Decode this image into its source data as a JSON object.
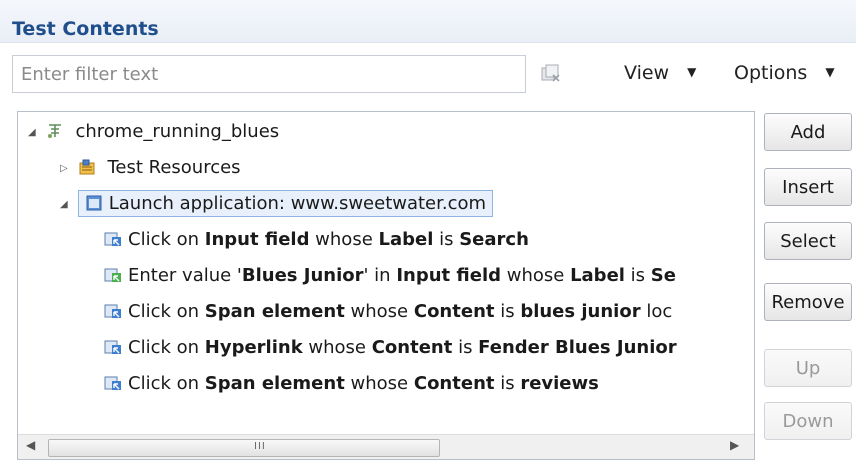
{
  "panel": {
    "title": "Test Contents"
  },
  "filter": {
    "placeholder": "Enter filter text",
    "value": ""
  },
  "menus": {
    "view_label": "View",
    "options_label": "Options"
  },
  "tree": {
    "root": {
      "label": "chrome_running_blues",
      "icon": "test-suite-icon"
    },
    "resources": {
      "label": "Test Resources",
      "icon": "test-resources-icon"
    },
    "launch": {
      "label": "Launch application: www.sweetwater.com",
      "icon": "application-icon"
    },
    "steps": [
      {
        "icon": "click-action-icon",
        "parts": [
          {
            "text": "Click on ",
            "bold": false
          },
          {
            "text": "Input field",
            "bold": true
          },
          {
            "text": " whose ",
            "bold": false
          },
          {
            "text": "Label",
            "bold": true
          },
          {
            "text": " is ",
            "bold": false
          },
          {
            "text": "Search",
            "bold": true
          }
        ]
      },
      {
        "icon": "enter-value-icon",
        "parts": [
          {
            "text": "Enter value '",
            "bold": false
          },
          {
            "text": "Blues Junior",
            "bold": true
          },
          {
            "text": "' in ",
            "bold": false
          },
          {
            "text": "Input field",
            "bold": true
          },
          {
            "text": " whose ",
            "bold": false
          },
          {
            "text": "Label",
            "bold": true
          },
          {
            "text": " is ",
            "bold": false
          },
          {
            "text": "Se",
            "bold": true
          }
        ]
      },
      {
        "icon": "click-action-icon",
        "parts": [
          {
            "text": "Click on ",
            "bold": false
          },
          {
            "text": "Span element",
            "bold": true
          },
          {
            "text": " whose ",
            "bold": false
          },
          {
            "text": "Content",
            "bold": true
          },
          {
            "text": " is ",
            "bold": false
          },
          {
            "text": "blues junior",
            "bold": true
          },
          {
            "text": " loc",
            "bold": false
          }
        ]
      },
      {
        "icon": "click-action-icon",
        "parts": [
          {
            "text": "Click on ",
            "bold": false
          },
          {
            "text": "Hyperlink",
            "bold": true
          },
          {
            "text": " whose ",
            "bold": false
          },
          {
            "text": "Content",
            "bold": true
          },
          {
            "text": " is ",
            "bold": false
          },
          {
            "text": "Fender Blues Junior",
            "bold": true
          }
        ]
      },
      {
        "icon": "click-action-icon",
        "parts": [
          {
            "text": "Click on ",
            "bold": false
          },
          {
            "text": "Span element",
            "bold": true
          },
          {
            "text": " whose ",
            "bold": false
          },
          {
            "text": "Content",
            "bold": true
          },
          {
            "text": " is ",
            "bold": false
          },
          {
            "text": "reviews",
            "bold": true
          }
        ]
      }
    ],
    "scrollbar_grip": "III"
  },
  "buttons": {
    "add": "Add",
    "insert": "Insert",
    "select": "Select",
    "remove": "Remove",
    "up": "Up",
    "down": "Down"
  },
  "colors": {
    "title": "#1f4e8c",
    "selection_border": "#8fb4e0",
    "selection_fill": "#e8f1fb"
  }
}
